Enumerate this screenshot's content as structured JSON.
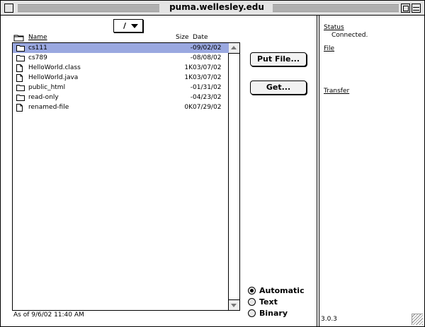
{
  "window": {
    "title": "puma.wellesley.edu"
  },
  "path": {
    "current": "/"
  },
  "columns": {
    "name": "Name",
    "size": "Size",
    "date": "Date"
  },
  "files": [
    {
      "name": "cs111",
      "size": "-",
      "date": "09/02/02",
      "type": "folder",
      "selected": true
    },
    {
      "name": "cs789",
      "size": "-",
      "date": "08/08/02",
      "type": "folder"
    },
    {
      "name": "HelloWorld.class",
      "size": "1K",
      "date": "03/07/02",
      "type": "file"
    },
    {
      "name": "HelloWorld.java",
      "size": "1K",
      "date": "03/07/02",
      "type": "file"
    },
    {
      "name": "public_html",
      "size": "-",
      "date": "01/31/02",
      "type": "folder"
    },
    {
      "name": "read-only",
      "size": "-",
      "date": "04/23/02",
      "type": "folder"
    },
    {
      "name": "renamed-file",
      "size": "0K",
      "date": "07/29/02",
      "type": "file"
    }
  ],
  "status_line": "As of 9/6/02 11:40 AM",
  "buttons": {
    "put": "Put File...",
    "get": "Get..."
  },
  "transfer_mode": {
    "options": [
      "Automatic",
      "Text",
      "Binary"
    ],
    "selected": "Automatic"
  },
  "info": {
    "status_label": "Status",
    "status_value": "Connected.",
    "file_label": "File",
    "transfer_label": "Transfer"
  },
  "version": "3.0.3",
  "colors": {
    "selection": "#9aa8e0"
  }
}
